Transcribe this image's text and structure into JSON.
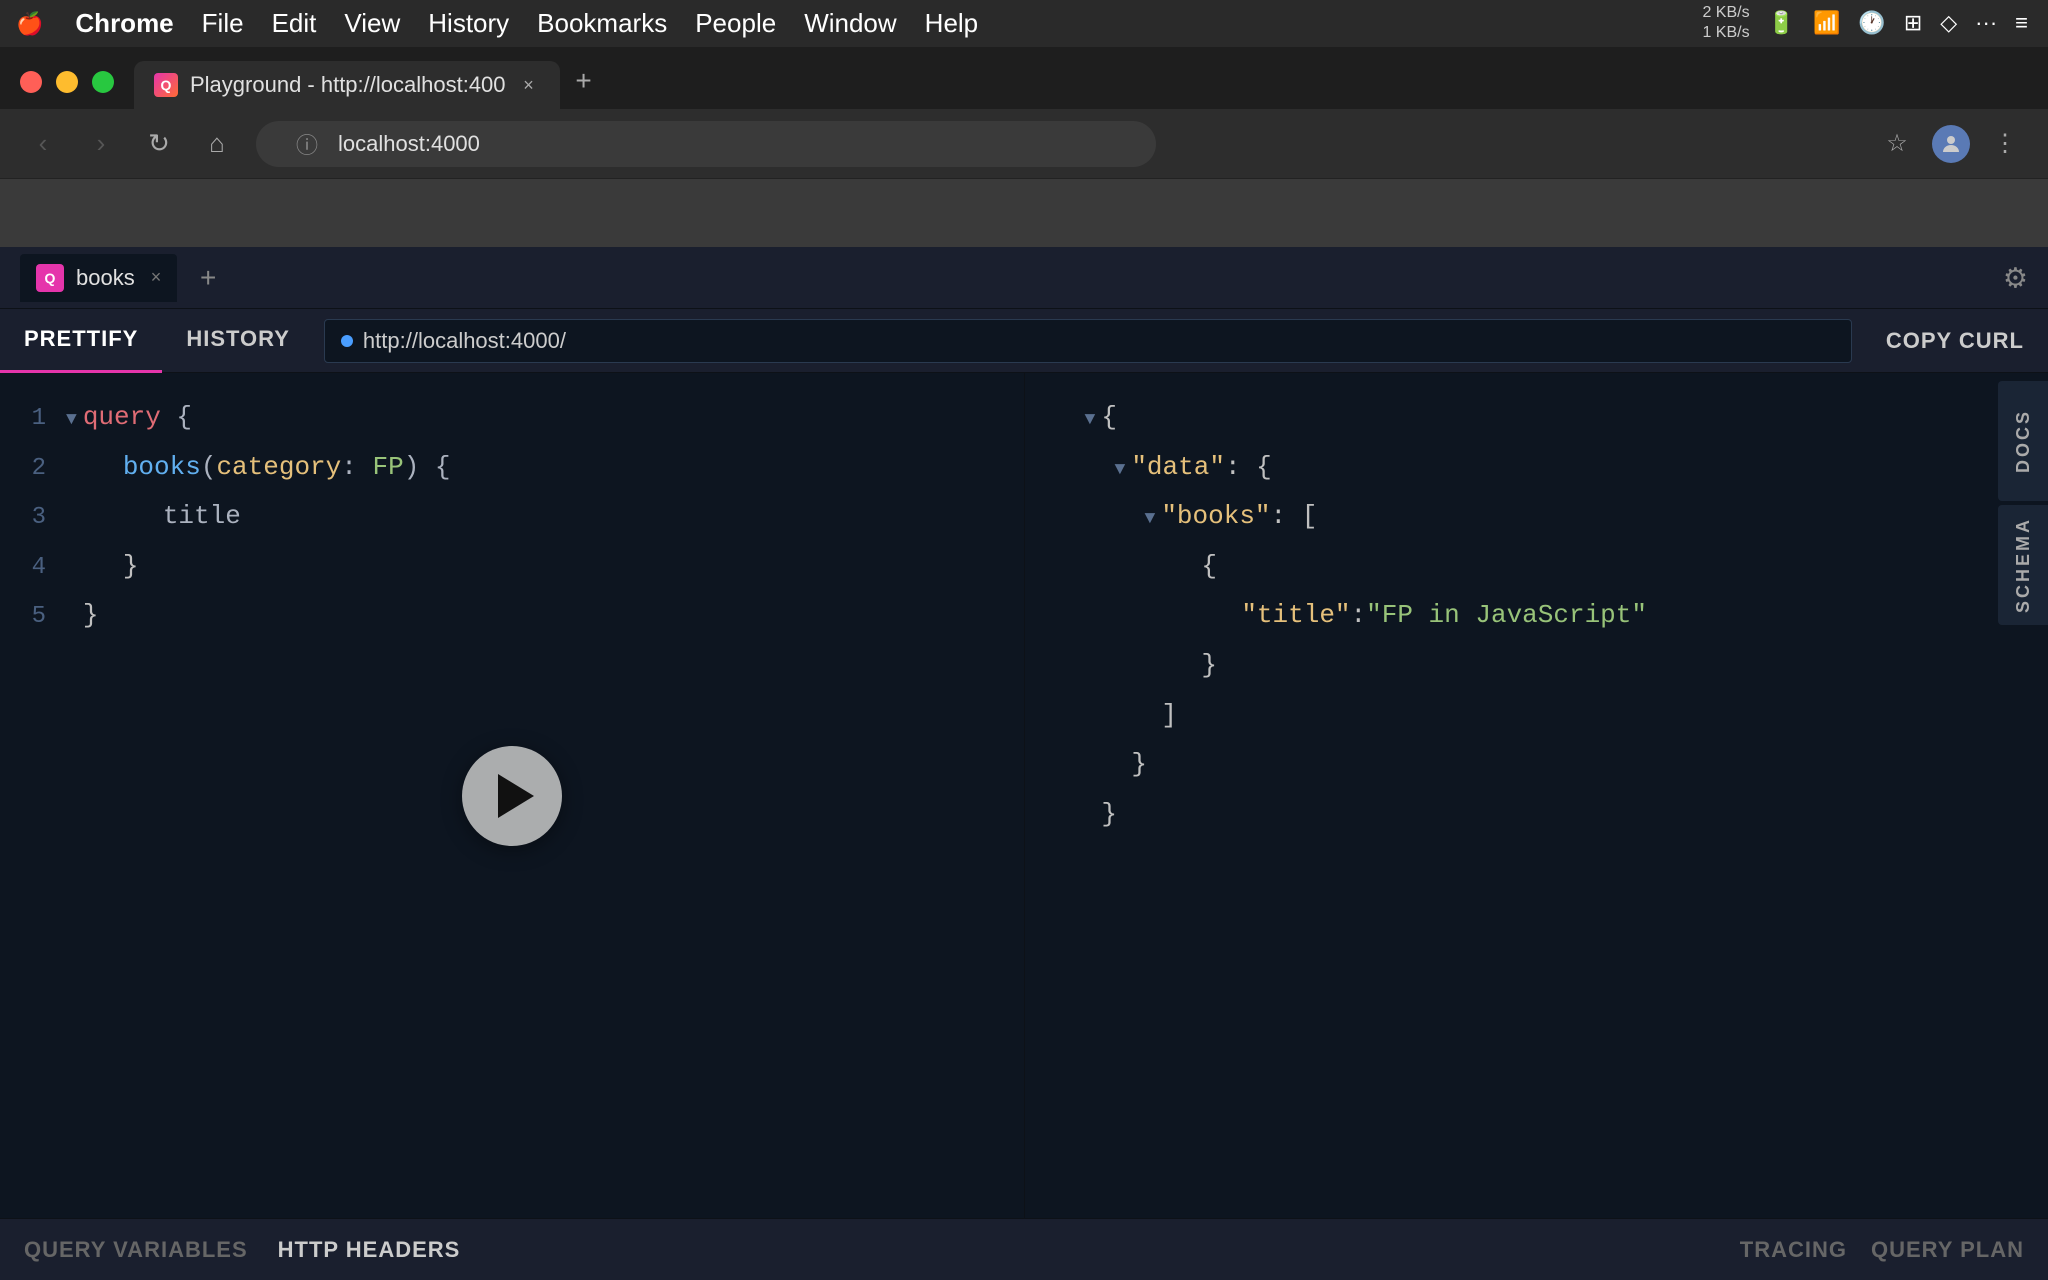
{
  "menubar": {
    "apple": "🍎",
    "items": [
      "Chrome",
      "File",
      "Edit",
      "View",
      "History",
      "Bookmarks",
      "People",
      "Window",
      "Help"
    ],
    "network": {
      "up": "2 KB/s",
      "down": "1 KB/s"
    }
  },
  "browser": {
    "tab": {
      "favicon_label": "Q",
      "title": "Playground - http://localhost:400",
      "close_label": "×"
    },
    "new_tab_label": "+",
    "nav": {
      "back_label": "‹",
      "forward_label": "›",
      "reload_label": "↻",
      "home_label": "⌂"
    },
    "address": {
      "icon": "ⓘ",
      "url": "localhost:4000"
    },
    "toolbar_right": {
      "star_label": "☆",
      "profile_label": "👤",
      "menu_label": "⋮"
    }
  },
  "playground": {
    "tab": {
      "icon_label": "Q",
      "name": "books",
      "close_label": "×"
    },
    "add_tab_label": "+",
    "settings_label": "⚙",
    "toolbar": {
      "prettify_label": "PRETTIFY",
      "history_label": "HISTORY",
      "url": "http://localhost:4000/",
      "copy_curl_label": "COPY CURL"
    },
    "editor": {
      "lines": [
        {
          "num": "1",
          "fold": "▼",
          "content": [
            {
              "text": "query",
              "cls": "kw-query"
            },
            {
              "text": " {",
              "cls": "kw-brace"
            }
          ]
        },
        {
          "num": "2",
          "indent": 1,
          "content": [
            {
              "text": "books",
              "cls": "kw-field"
            },
            {
              "text": "(",
              "cls": "kw-white"
            },
            {
              "text": "category",
              "cls": "kw-arg"
            },
            {
              "text": ": ",
              "cls": "kw-white"
            },
            {
              "text": "FP",
              "cls": "kw-val"
            },
            {
              "text": ") {",
              "cls": "kw-white"
            }
          ]
        },
        {
          "num": "3",
          "indent": 2,
          "content": [
            {
              "text": "title",
              "cls": "kw-title"
            }
          ]
        },
        {
          "num": "4",
          "indent": 1,
          "content": [
            {
              "text": "}",
              "cls": "kw-brace"
            }
          ]
        },
        {
          "num": "5",
          "indent": 0,
          "content": [
            {
              "text": "}",
              "cls": "kw-brace"
            }
          ]
        }
      ]
    },
    "response": {
      "lines": [
        {
          "fold": "▼",
          "content": [
            {
              "text": "{",
              "cls": "json-brace"
            }
          ]
        },
        {
          "fold": "▼",
          "indent": 1,
          "content": [
            {
              "text": "\"data\"",
              "cls": "json-key"
            },
            {
              "text": ": {",
              "cls": "json-colon"
            }
          ]
        },
        {
          "fold": "▼",
          "indent": 2,
          "content": [
            {
              "text": "\"books\"",
              "cls": "json-key"
            },
            {
              "text": ": [",
              "cls": "json-colon"
            }
          ]
        },
        {
          "fold": "",
          "indent": 3,
          "content": [
            {
              "text": "{",
              "cls": "json-brace"
            }
          ]
        },
        {
          "fold": "",
          "indent": 4,
          "content": [
            {
              "text": "\"title\"",
              "cls": "json-key"
            },
            {
              "text": ": ",
              "cls": "json-colon"
            },
            {
              "text": "\"FP in JavaScript\"",
              "cls": "json-str"
            }
          ]
        },
        {
          "fold": "",
          "indent": 3,
          "content": [
            {
              "text": "}",
              "cls": "json-brace"
            }
          ]
        },
        {
          "fold": "",
          "indent": 2,
          "content": [
            {
              "text": "]",
              "cls": "json-brace"
            }
          ]
        },
        {
          "fold": "",
          "indent": 1,
          "content": [
            {
              "text": "}",
              "cls": "json-brace"
            }
          ]
        },
        {
          "fold": "",
          "indent": 0,
          "content": [
            {
              "text": "}",
              "cls": "json-brace"
            }
          ]
        }
      ]
    },
    "side_panels": [
      {
        "label": "DOCS"
      },
      {
        "label": "SCHEMA"
      }
    ],
    "bottom": {
      "left": [
        "QUERY VARIABLES",
        "HTTP HEADERS"
      ],
      "right": [
        "TRACING",
        "QUERY PLAN"
      ]
    }
  }
}
